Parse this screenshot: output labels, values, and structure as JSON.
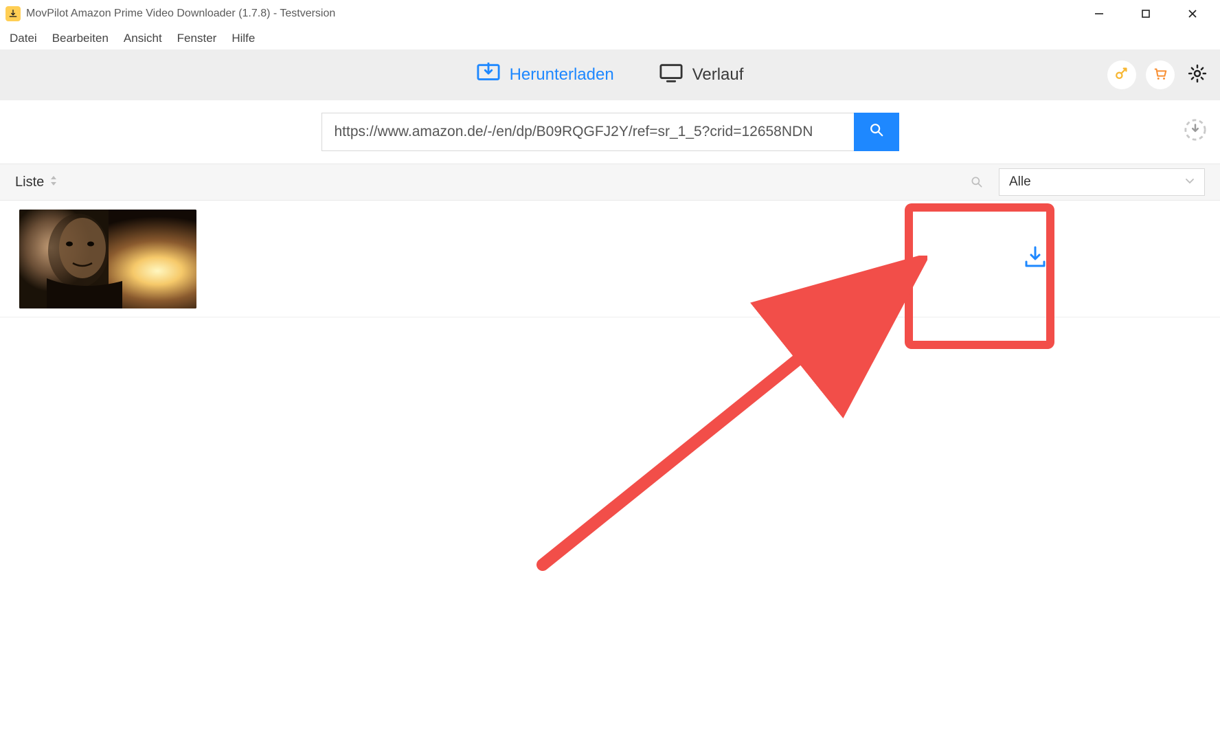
{
  "window": {
    "title": "MovPilot Amazon Prime Video Downloader (1.7.8) - Testversion"
  },
  "menu": {
    "items": [
      "Datei",
      "Bearbeiten",
      "Ansicht",
      "Fenster",
      "Hilfe"
    ]
  },
  "tabs": {
    "download_label": "Herunterladen",
    "history_label": "Verlauf"
  },
  "search": {
    "url_value": "https://www.amazon.de/-/en/dp/B09RQGFJ2Y/ref=sr_1_5?crid=12658NDN"
  },
  "filter": {
    "list_label": "Liste",
    "dropdown_value": "Alle"
  },
  "colors": {
    "accent": "#1e88ff",
    "highlight": "#f24e49",
    "key_icon": "#f7b733",
    "cart_icon": "#f78f33"
  }
}
